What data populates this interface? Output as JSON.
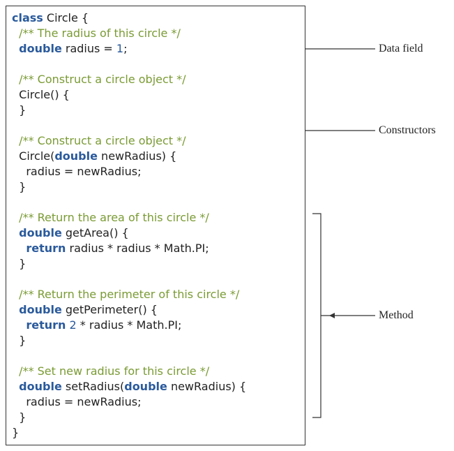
{
  "code": {
    "l1a": "class",
    "l1b": " Circle {",
    "l2a": "  ",
    "l2b": "/** The radius of this circle */",
    "l3a": "  ",
    "l3b": "double",
    "l3c": " radius = ",
    "l3d": "1",
    "l3e": ";",
    "l4": "",
    "l5a": "  ",
    "l5b": "/** Construct a circle object */",
    "l6": "  Circle() {",
    "l7": "  }",
    "l8": "",
    "l9a": "  ",
    "l9b": "/** Construct a circle object */",
    "l10a": "  Circle(",
    "l10b": "double",
    "l10c": " newRadius) {",
    "l11": "    radius = newRadius;",
    "l12": "  }",
    "l13": "",
    "l14a": "  ",
    "l14b": "/** Return the area of this circle */",
    "l15a": "  ",
    "l15b": "double",
    "l15c": " getArea() {",
    "l16a": "    ",
    "l16b": "return",
    "l16c": " radius * radius * Math.PI;",
    "l17": "  }",
    "l18": "",
    "l19a": "  ",
    "l19b": "/** Return the perimeter of this circle */",
    "l20a": "  ",
    "l20b": "double",
    "l20c": " getPerimeter() {",
    "l21a": "    ",
    "l21b": "return",
    "l21c": " ",
    "l21d": "2",
    "l21e": " * radius * Math.PI;",
    "l22": "  }",
    "l23": "",
    "l24a": "  ",
    "l24b": "/** Set new radius for this circle */",
    "l25a": "  ",
    "l25b": "double",
    "l25c": " setRadius(",
    "l25d": "double",
    "l25e": " newRadius) {",
    "l26": "    radius = newRadius;",
    "l27": "  }",
    "l28": "}"
  },
  "labels": {
    "datafield": "Data field",
    "constructors": "Constructors",
    "method": "Method"
  }
}
